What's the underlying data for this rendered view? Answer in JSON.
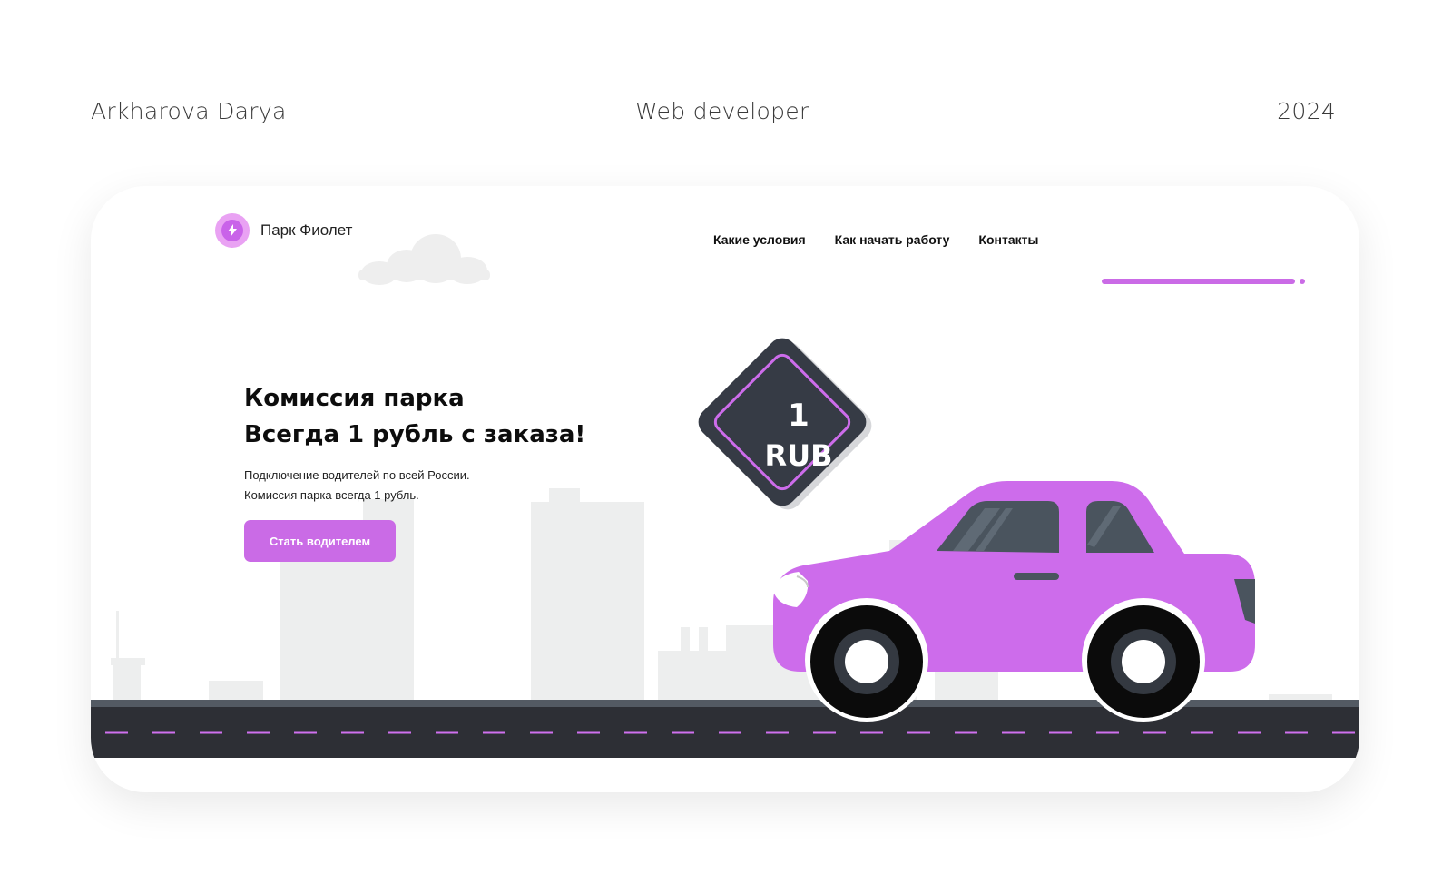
{
  "portfolio": {
    "author": "Arkharova Darya",
    "role": "Web developer",
    "year": "2024"
  },
  "site": {
    "brand": "Парк Фиолет",
    "nav": [
      {
        "label": "Какие условия"
      },
      {
        "label": "Как начать работу"
      },
      {
        "label": "Контакты"
      }
    ],
    "hero": {
      "title_line1": "Комиссия парка",
      "title_line2": "Всегда 1 рубль с заказа!",
      "text_line1": "Подключение водителей по всей России.",
      "text_line2": "Комиссия парка всегда 1 рубль.",
      "cta_label": "Стать водителем"
    },
    "sign": {
      "value": "1",
      "currency": "RUB"
    }
  },
  "colors": {
    "accent": "#ca6be6",
    "car": "#cd6ceb",
    "dark": "#363b45",
    "road": "#2d2f35",
    "city": "#edeeee"
  }
}
